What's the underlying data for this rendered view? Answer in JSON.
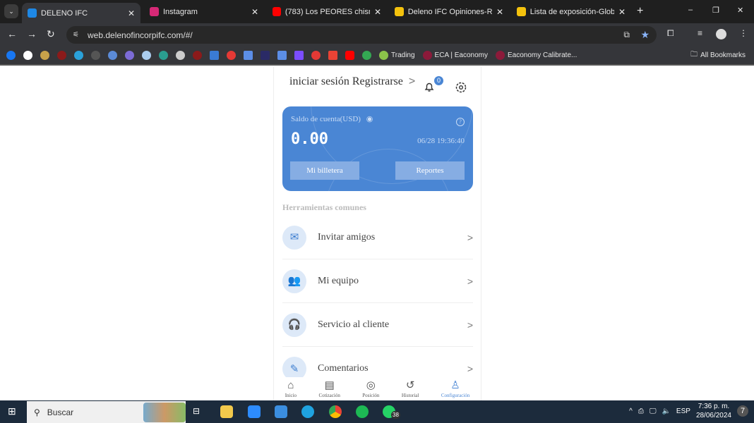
{
  "browser": {
    "tabs": [
      {
        "title": "DELENO IFC",
        "active": true,
        "color": "#1e88e5"
      },
      {
        "title": "Instagram",
        "color": "#d62976"
      },
      {
        "title": "(783) Los PEORES chismes d",
        "color": "#ff0000"
      },
      {
        "title": "Deleno IFC Opiniones-Reseñ",
        "color": "#f4c20d"
      },
      {
        "title": "Lista de exposición-Global E",
        "color": "#f4c20d"
      }
    ],
    "url": "web.delenofincorpifc.com/#/",
    "bookmarks": [
      "Trading",
      "ECA | Eaconomy",
      "Eaconomy Calibrate..."
    ],
    "all_bookmarks": "All Bookmarks"
  },
  "header": {
    "login": "iniciar sesión Registrarse",
    "notifications": "0"
  },
  "account": {
    "label": "Saldo de cuenta(USD)",
    "balance": "0.00",
    "timestamp": "06/28 19:36:40",
    "wallet_button": "Mi billetera",
    "reports_button": "Reportes"
  },
  "tools": {
    "heading": "Herramientas comunes",
    "items": [
      {
        "label": "Invitar amigos"
      },
      {
        "label": "Mi equipo"
      },
      {
        "label": "Servicio al cliente"
      },
      {
        "label": "Comentarios"
      }
    ]
  },
  "nav": [
    {
      "label": "Inicio"
    },
    {
      "label": "Cotización"
    },
    {
      "label": "Posición"
    },
    {
      "label": "Historial"
    },
    {
      "label": "Configuración",
      "active": true
    }
  ],
  "taskbar": {
    "search": "Buscar",
    "whatsapp_badge": "38",
    "language": "ESP",
    "time": "7:36 p. m.",
    "date": "28/06/2024",
    "notifications": "7"
  }
}
